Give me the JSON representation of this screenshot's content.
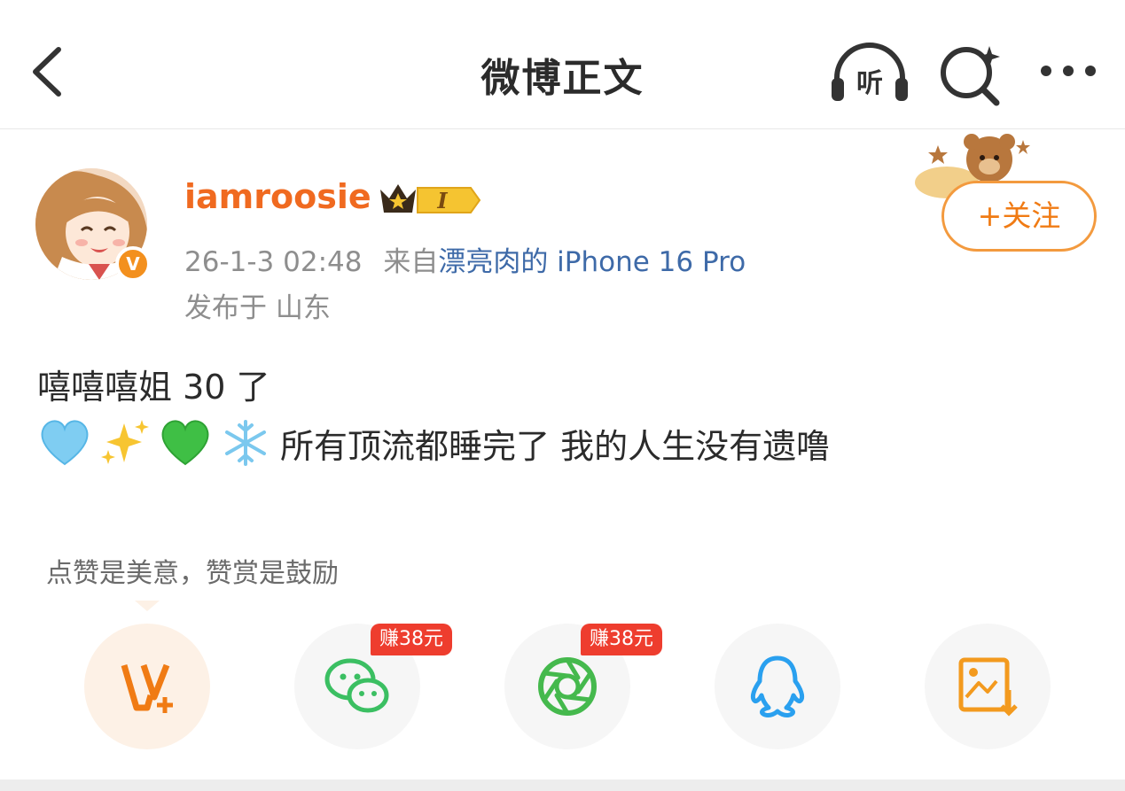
{
  "header": {
    "title": "微博正文",
    "listen_label": "听"
  },
  "author": {
    "username": "iamroosie",
    "vip_level": "I",
    "verified_mark": "V",
    "timestamp": "26-1-3 02:48",
    "source_prefix": "来自",
    "device": "漂亮肉的 iPhone 16 Pro",
    "location": "发布于 山东",
    "follow_label": "+关注"
  },
  "post": {
    "line1": "嘻嘻嘻姐 30 了",
    "emojis": [
      "light-blue-heart",
      "sparkles",
      "green-heart",
      "snowflake"
    ],
    "line2_text": "所有顶流都睡完了 我的人生没有遗噜"
  },
  "reward": {
    "tip": "点赞是美意，赞赏是鼓励"
  },
  "share": {
    "buttons": [
      {
        "icon": "weibo-vplus-icon"
      },
      {
        "icon": "wechat-icon",
        "badge": "赚38元"
      },
      {
        "icon": "moments-icon",
        "badge": "赚38元"
      },
      {
        "icon": "qq-icon"
      },
      {
        "icon": "save-image-icon"
      }
    ]
  },
  "colors": {
    "username": "#f06a20",
    "device_link": "#3e6aa8",
    "follow_border": "#f39a3e",
    "earn_badge": "#ee3d2e"
  }
}
